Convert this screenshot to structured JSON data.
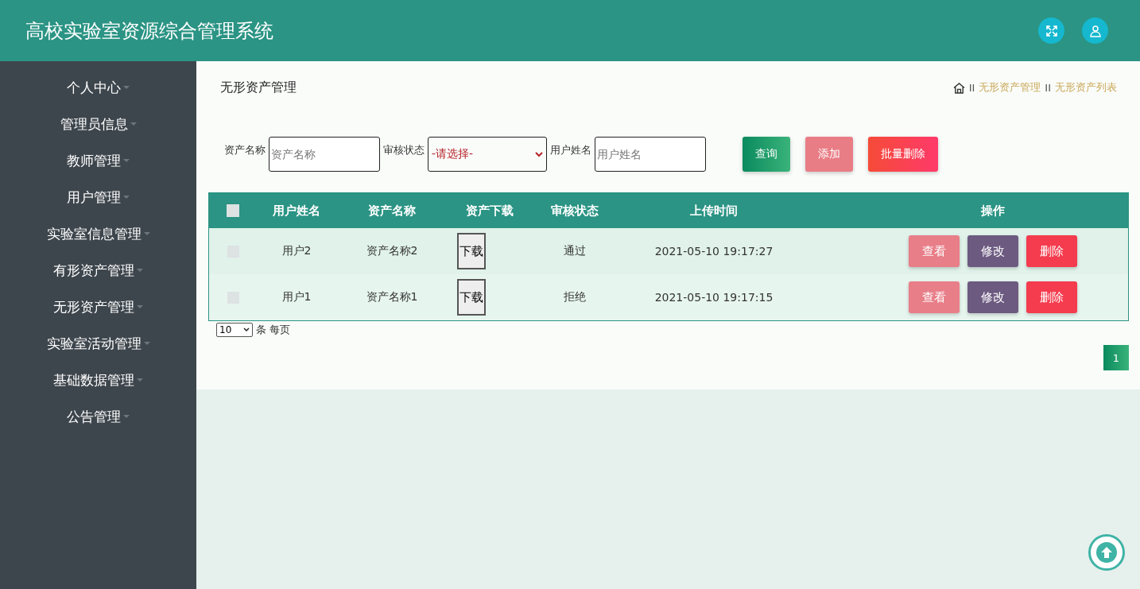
{
  "header": {
    "title": "高校实验室资源综合管理系统"
  },
  "sidebar": {
    "items": [
      {
        "label": "个人中心"
      },
      {
        "label": "管理员信息"
      },
      {
        "label": "教师管理"
      },
      {
        "label": "用户管理"
      },
      {
        "label": "实验室信息管理"
      },
      {
        "label": "有形资产管理"
      },
      {
        "label": "无形资产管理"
      },
      {
        "label": "实验室活动管理"
      },
      {
        "label": "基础数据管理"
      },
      {
        "label": "公告管理"
      }
    ]
  },
  "page": {
    "title": "无形资产管理",
    "breadcrumb": [
      {
        "label": "II",
        "kind": "sep"
      },
      {
        "label": "无形资产管理",
        "kind": "link"
      },
      {
        "label": "II",
        "kind": "sep"
      },
      {
        "label": "无形资产列表",
        "kind": "link"
      }
    ]
  },
  "filters": [
    {
      "label": "资产名称",
      "kind": "input",
      "placeholder": "资产名称"
    },
    {
      "label": "审核状态",
      "kind": "select",
      "value": "-请选择-"
    },
    {
      "label": "用户姓名",
      "kind": "input",
      "placeholder": "用户姓名"
    }
  ],
  "actions": [
    {
      "label": "查询",
      "kind": "search"
    },
    {
      "label": "添加",
      "kind": "add"
    },
    {
      "label": "批量删除",
      "kind": "delete"
    }
  ],
  "table": {
    "select_all": {
      "checked": false
    },
    "columns": [
      "用户姓名",
      "资产名称",
      "资产下载",
      "审核状态",
      "上传时间",
      "操作"
    ],
    "rows": [
      {
        "checked": false,
        "user": "用户2",
        "asset": "资产名称2",
        "download": "下载",
        "status": "通过",
        "time": "2021-05-10 19:17:27",
        "buttons": [
          "查看",
          "修改",
          "删除"
        ]
      },
      {
        "checked": false,
        "user": "用户1",
        "asset": "资产名称1",
        "download": "下载",
        "status": "拒绝",
        "time": "2021-05-10 19:17:15",
        "buttons": [
          "查看",
          "修改",
          "删除"
        ]
      }
    ]
  },
  "pagination": {
    "page_size": "10",
    "page_size_label": "条 每页",
    "pages": [
      {
        "label": "1",
        "selected": true
      }
    ]
  }
}
